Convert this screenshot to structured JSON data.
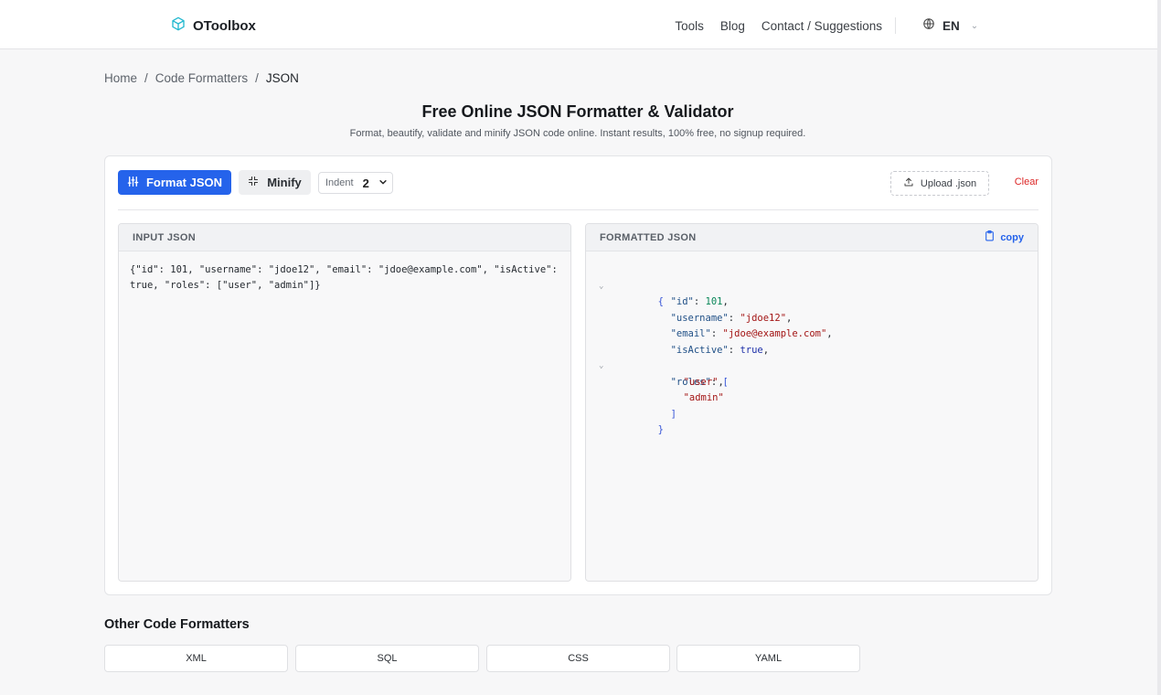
{
  "header": {
    "logo_text": "OToolbox",
    "nav": [
      "Tools",
      "Blog",
      "Contact / Suggestions"
    ],
    "language": "EN"
  },
  "breadcrumb": {
    "home": "Home",
    "category": "Code Formatters",
    "current": "JSON",
    "separator": "/"
  },
  "page": {
    "title": "Free Online JSON Formatter & Validator",
    "subtitle": "Format, beautify, validate and minify JSON code online. Instant results, 100% free, no signup required."
  },
  "toolbar": {
    "format_label": "Format JSON",
    "minify_label": "Minify",
    "indent_label": "Indent",
    "indent_value": "2",
    "upload_label": "Upload .json",
    "clear_label": "Clear"
  },
  "input_pane": {
    "title": "INPUT JSON",
    "value": "{\"id\": 101, \"username\": \"jdoe12\", \"email\": \"jdoe@example.com\", \"isActive\": true, \"roles\": [\"user\", \"admin\"]}"
  },
  "output_pane": {
    "title": "FORMATTED JSON",
    "copy_label": "copy",
    "lines": {
      "open": "{",
      "id_key": "\"id\"",
      "id_val": "101",
      "username_key": "\"username\"",
      "username_val": "\"jdoe12\"",
      "email_key": "\"email\"",
      "email_val": "\"jdoe@example.com\"",
      "active_key": "\"isActive\"",
      "active_val": "true",
      "roles_key": "\"roles\"",
      "roles_open": "[",
      "role1": "\"user\"",
      "role2": "\"admin\"",
      "roles_close": "]",
      "close": "}",
      "colon": ": ",
      "comma": ","
    }
  },
  "other": {
    "title": "Other Code Formatters",
    "items": [
      "XML",
      "SQL",
      "CSS",
      "YAML"
    ]
  },
  "colors": {
    "primary": "#2563eb",
    "danger": "#dc2626",
    "logo_icon": "#22b8cf"
  }
}
